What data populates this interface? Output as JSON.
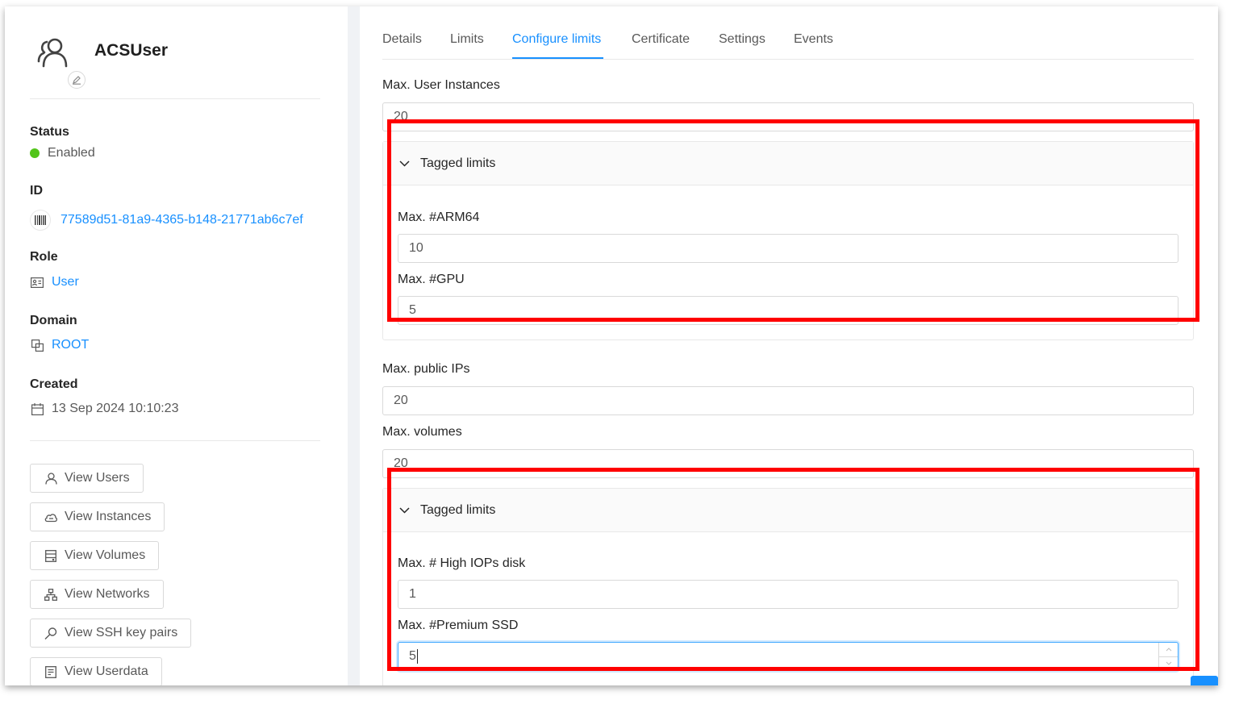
{
  "user": {
    "name": "ACSUser"
  },
  "info": {
    "status": {
      "label": "Status",
      "value": "Enabled",
      "color": "#52c41a"
    },
    "id": {
      "label": "ID",
      "value": "77589d51-81a9-4365-b148-21771ab6c7ef"
    },
    "role": {
      "label": "Role",
      "value": "User"
    },
    "domain": {
      "label": "Domain",
      "value": "ROOT"
    },
    "created": {
      "label": "Created",
      "value": "13 Sep 2024 10:10:23"
    }
  },
  "actions": [
    {
      "label": "View Users",
      "icon": "user-icon"
    },
    {
      "label": "View Instances",
      "icon": "cloud-icon"
    },
    {
      "label": "View Volumes",
      "icon": "hdd-icon"
    },
    {
      "label": "View Networks",
      "icon": "network-icon"
    },
    {
      "label": "View SSH key pairs",
      "icon": "key-icon"
    },
    {
      "label": "View Userdata",
      "icon": "solution-icon"
    }
  ],
  "tabs": [
    {
      "label": "Details"
    },
    {
      "label": "Limits"
    },
    {
      "label": "Configure limits",
      "active": true
    },
    {
      "label": "Certificate"
    },
    {
      "label": "Settings"
    },
    {
      "label": "Events"
    }
  ],
  "form": {
    "max_user_instances": {
      "label": "Max. User Instances",
      "value": "20"
    },
    "tagged_1": {
      "title": "Tagged limits",
      "arm64": {
        "label": "Max. #ARM64",
        "value": "10"
      },
      "gpu": {
        "label": "Max. #GPU",
        "value": "5"
      }
    },
    "max_public_ips": {
      "label": "Max. public IPs",
      "value": "20"
    },
    "max_volumes": {
      "label": "Max. volumes",
      "value": "20"
    },
    "tagged_2": {
      "title": "Tagged limits",
      "high_iops": {
        "label": "Max. # High IOPs disk",
        "value": "1"
      },
      "premium_ssd": {
        "label": "Max. #Premium SSD",
        "value": "5"
      }
    }
  },
  "colors": {
    "accent": "#1890ff",
    "highlight": "#ff0000"
  }
}
